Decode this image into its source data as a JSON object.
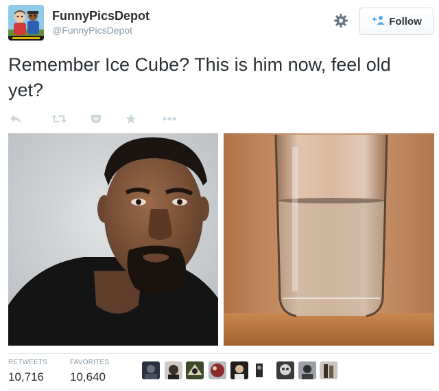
{
  "account": {
    "display_name": "FunnyPicsDepot",
    "handle": "@FunnyPicsDepot",
    "follow_label": "Follow"
  },
  "tweet": {
    "text": "Remember Ice Cube? This is him now, feel old yet?"
  },
  "actions": [
    {
      "name": "reply",
      "icon": "reply-icon"
    },
    {
      "name": "retweet",
      "icon": "retweet-icon"
    },
    {
      "name": "pocket",
      "icon": "pocket-icon"
    },
    {
      "name": "favorite",
      "icon": "star-icon"
    },
    {
      "name": "more",
      "icon": "more-icon"
    }
  ],
  "stats": {
    "retweets_label": "RETWEETS",
    "retweets_value": "10,716",
    "favorites_label": "FAVORITES",
    "favorites_value": "10,640"
  },
  "colors": {
    "text": "#292f33",
    "muted": "#8899a6",
    "action_icon": "#ccd6dd",
    "follow_icon": "#55acee",
    "divider": "#e1e8ed"
  }
}
